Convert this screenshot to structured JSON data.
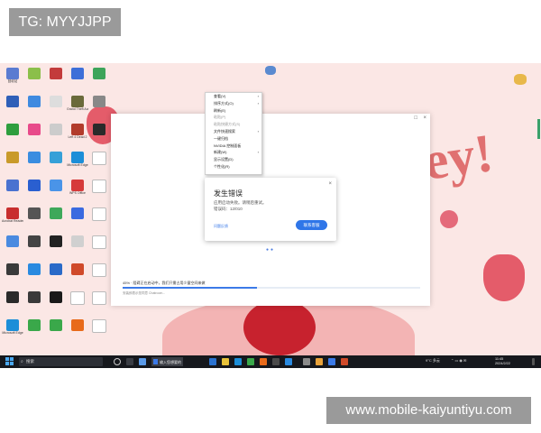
{
  "watermark_top": "TG: MYYJJPP",
  "watermark_bottom": "www.mobile-kaiyuntiyu.com",
  "desktop": {
    "wallpaper_text": "ey!",
    "icons": [
      {
        "label": "回收站",
        "color": "#5a7bd1"
      },
      {
        "label": "",
        "color": "#8bbf4a"
      },
      {
        "label": "",
        "color": "#c33b3b"
      },
      {
        "label": "",
        "color": "#3e6fd8"
      },
      {
        "label": "",
        "color": "#3da45a"
      },
      {
        "label": "",
        "color": "#2f5fb8"
      },
      {
        "label": "",
        "color": "#3f8ae0"
      },
      {
        "label": "",
        "color": "#dddddd"
      },
      {
        "label": "Grand Theft Auto V",
        "color": "#6a6a3a"
      },
      {
        "label": "",
        "color": "#888888"
      },
      {
        "label": "",
        "color": "#2e9e3e"
      },
      {
        "label": "",
        "color": "#e84a8a"
      },
      {
        "label": "",
        "color": "#cccccc"
      },
      {
        "label": "Left 4 Dead 2",
        "color": "#b23b2b"
      },
      {
        "label": "",
        "color": "#2a2a2a"
      },
      {
        "label": "",
        "color": "#c99a2a"
      },
      {
        "label": "",
        "color": "#3a8de0"
      },
      {
        "label": "",
        "color": "#36a0d8"
      },
      {
        "label": "Microsoft Edge",
        "color": "#1c8ed8"
      },
      {
        "label": "",
        "color": "#ffffff"
      },
      {
        "label": "",
        "color": "#4a72d0"
      },
      {
        "label": "",
        "color": "#2a5fd0"
      },
      {
        "label": "",
        "color": "#4a94e8"
      },
      {
        "label": "WPS Office",
        "color": "#d63a3a"
      },
      {
        "label": "",
        "color": "#ffffff"
      },
      {
        "label": "Acrobat Reader DC",
        "color": "#c82e2e"
      },
      {
        "label": "",
        "color": "#555555"
      },
      {
        "label": "",
        "color": "#3ea85a"
      },
      {
        "label": "",
        "color": "#3a6ae0"
      },
      {
        "label": "",
        "color": "#ffffff"
      },
      {
        "label": "",
        "color": "#4a8ae0"
      },
      {
        "label": "",
        "color": "#444444"
      },
      {
        "label": "",
        "color": "#222222"
      },
      {
        "label": "",
        "color": "#d0d0d0"
      },
      {
        "label": "",
        "color": "#ffffff"
      },
      {
        "label": "",
        "color": "#3a3a3a"
      },
      {
        "label": "",
        "color": "#2a8ae0"
      },
      {
        "label": "",
        "color": "#2a6ac8"
      },
      {
        "label": "",
        "color": "#d04a2a"
      },
      {
        "label": "",
        "color": "#ffffff"
      },
      {
        "label": "",
        "color": "#2a2a2a"
      },
      {
        "label": "",
        "color": "#3a3a3a"
      },
      {
        "label": "",
        "color": "#1a1a1a"
      },
      {
        "label": "",
        "color": "#ffffff"
      },
      {
        "label": "",
        "color": "#ffffff"
      },
      {
        "label": "Microsoft Edge",
        "color": "#1c8ed8"
      },
      {
        "label": "",
        "color": "#3aa84a"
      },
      {
        "label": "",
        "color": "#3aa84a"
      },
      {
        "label": "",
        "color": "#e86a1a"
      },
      {
        "label": "",
        "color": "#ffffff"
      }
    ]
  },
  "context_menu": {
    "items": [
      {
        "label": "查看(V)",
        "arrow": true,
        "disabled": false
      },
      {
        "label": "排序方式(O)",
        "arrow": true,
        "disabled": false
      },
      {
        "label": "刷新(E)",
        "arrow": false,
        "disabled": false
      },
      {
        "label": "粘贴(P)",
        "arrow": false,
        "disabled": true
      },
      {
        "label": "粘贴快捷方式(S)",
        "arrow": false,
        "disabled": true
      },
      {
        "label": "文件快速搜索",
        "arrow": true,
        "disabled": false
      },
      {
        "label": "一键归档",
        "arrow": false,
        "disabled": false
      },
      {
        "label": "NVIDIA 控制面板",
        "arrow": false,
        "disabled": false
      },
      {
        "label": "新建(W)",
        "arrow": true,
        "disabled": false
      },
      {
        "label": "显示设置(D)",
        "arrow": false,
        "disabled": false
      },
      {
        "label": "个性化(R)",
        "arrow": false,
        "disabled": false
      }
    ]
  },
  "installer": {
    "progress_text": "45%  · 阻碍正在启动中，我们只需占用少量空间来做",
    "progress_percent": 45,
    "footer_text": "安装即表示您同意 Chatroom...",
    "accent": "#3b7ae8"
  },
  "error_dialog": {
    "title": "发生错误",
    "message": "应用启动失败。请稍后重试。",
    "code": "错误码：12/010",
    "link": "问题反馈",
    "button": "联系客服",
    "close": "×"
  },
  "taskbar": {
    "search_placeholder": "搜索",
    "active_app_label": "输入您想要的",
    "tray_weather": "9°C 多云",
    "time": "11:45",
    "date": "2024/2/22"
  }
}
